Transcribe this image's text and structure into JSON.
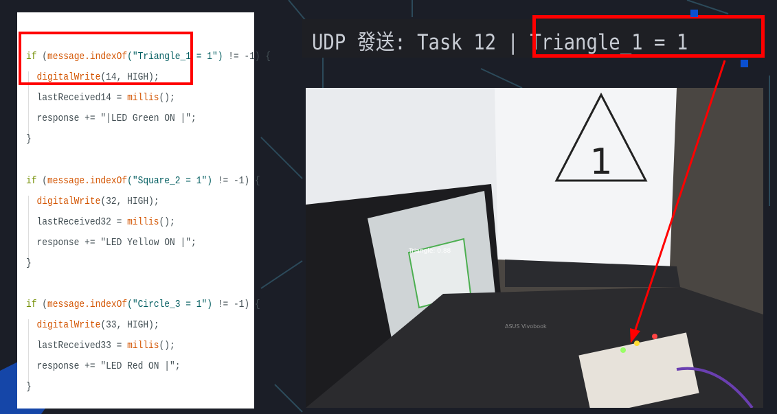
{
  "code": {
    "blocks": [
      {
        "lines": [
          [
            {
              "t": "if",
              "c": "kw"
            },
            {
              "t": " (",
              "c": "txt"
            },
            {
              "t": "message.indexOf",
              "c": "fn"
            },
            {
              "t": "(\"Triangle_1 = 1\")",
              "c": "str"
            },
            {
              "t": " != -1) {",
              "c": "txt"
            }
          ],
          [
            {
              "t": "  ",
              "c": "txt"
            },
            {
              "t": "digitalWrite",
              "c": "fn"
            },
            {
              "t": "(14, HIGH);",
              "c": "txt"
            }
          ],
          [
            {
              "t": "  lastReceived14 = ",
              "c": "txt"
            },
            {
              "t": "millis",
              "c": "fn"
            },
            {
              "t": "();",
              "c": "txt"
            }
          ],
          [
            {
              "t": "  response += \"|LED Green ON |\";",
              "c": "txt"
            }
          ],
          [
            {
              "t": "}",
              "c": "txt"
            }
          ]
        ]
      },
      {
        "lines": [
          [
            {
              "t": "if",
              "c": "kw"
            },
            {
              "t": " (",
              "c": "txt"
            },
            {
              "t": "message.indexOf",
              "c": "fn"
            },
            {
              "t": "(\"Square_2 = 1\")",
              "c": "str"
            },
            {
              "t": " != -1) {",
              "c": "txt"
            }
          ],
          [
            {
              "t": "  ",
              "c": "txt"
            },
            {
              "t": "digitalWrite",
              "c": "fn"
            },
            {
              "t": "(32, HIGH);",
              "c": "txt"
            }
          ],
          [
            {
              "t": "  lastReceived32 = ",
              "c": "txt"
            },
            {
              "t": "millis",
              "c": "fn"
            },
            {
              "t": "();",
              "c": "txt"
            }
          ],
          [
            {
              "t": "  response += \"LED Yellow ON |\";",
              "c": "txt"
            }
          ],
          [
            {
              "t": "}",
              "c": "txt"
            }
          ]
        ]
      },
      {
        "lines": [
          [
            {
              "t": "if",
              "c": "kw"
            },
            {
              "t": " (",
              "c": "txt"
            },
            {
              "t": "message.indexOf",
              "c": "fn"
            },
            {
              "t": "(\"Circle_3 = 1\")",
              "c": "str"
            },
            {
              "t": " != -1) {",
              "c": "txt"
            }
          ],
          [
            {
              "t": "  ",
              "c": "txt"
            },
            {
              "t": "digitalWrite",
              "c": "fn"
            },
            {
              "t": "(33, HIGH);",
              "c": "txt"
            }
          ],
          [
            {
              "t": "  lastReceived33 = ",
              "c": "txt"
            },
            {
              "t": "millis",
              "c": "fn"
            },
            {
              "t": "();",
              "c": "txt"
            }
          ],
          [
            {
              "t": "  response += \"LED Red ON |\";",
              "c": "txt"
            }
          ],
          [
            {
              "t": "}",
              "c": "txt"
            }
          ]
        ]
      }
    ]
  },
  "udp": {
    "text": "UDP 發送: Task 12 | Triangle_1 = 1"
  },
  "photo": {
    "triangle_label": "1",
    "detection_label": "Triangle: 0.88",
    "laptop_brand": "ASUS Vivobook"
  },
  "colors": {
    "highlight": "#ff0000",
    "background": "#1b1e27"
  }
}
